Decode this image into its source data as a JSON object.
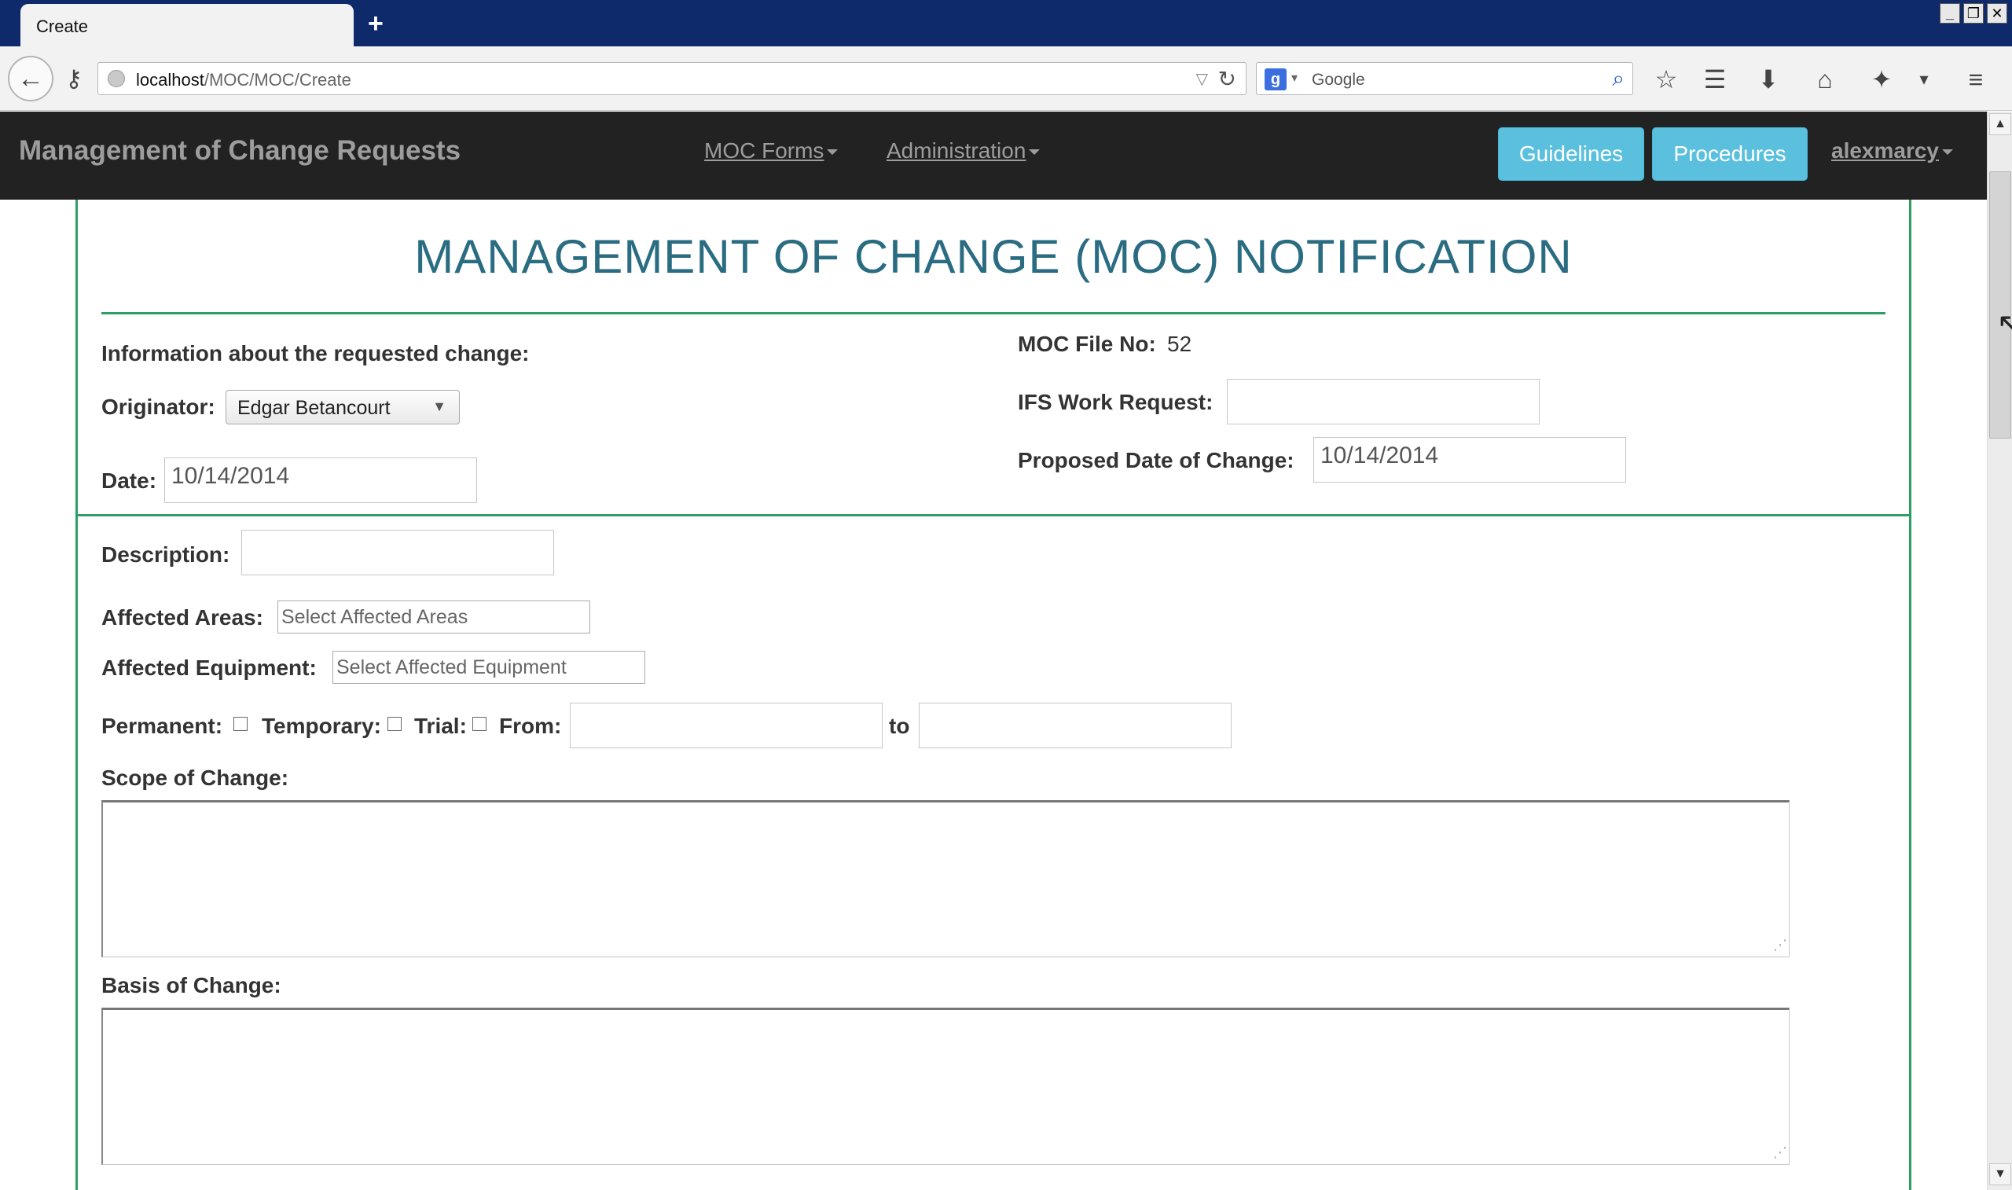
{
  "browser": {
    "tab_title": "Create",
    "new_tab_symbol": "+",
    "url_host": "localhost",
    "url_path": "/MOC/MOC/Create",
    "search_engine_placeholder": "Google",
    "window_minimize": "_",
    "window_restore": "❐",
    "window_close": "✕"
  },
  "app": {
    "brand": "Management of Change Requests",
    "nav": {
      "moc_forms": "MOC Forms",
      "administration": "Administration",
      "guidelines": "Guidelines",
      "procedures": "Procedures",
      "user": "alexmarcy"
    }
  },
  "form": {
    "title": "MANAGEMENT OF CHANGE (MOC) NOTIFICATION",
    "info_heading": "Information about the requested change:",
    "originator_label": "Originator:",
    "originator_value": "Edgar Betancourt",
    "date_label": "Date:",
    "date_value": "10/14/2014",
    "moc_file_no_label": "MOC File No:",
    "moc_file_no_value": "52",
    "ifs_work_request_label": "IFS Work Request:",
    "ifs_work_request_value": "",
    "proposed_date_label": "Proposed Date of Change:",
    "proposed_date_value": "10/14/2014",
    "description_label": "Description:",
    "description_value": "",
    "affected_areas_label": "Affected Areas:",
    "affected_areas_placeholder": "Select Affected Areas",
    "affected_equipment_label": "Affected Equipment:",
    "affected_equipment_placeholder": "Select Affected Equipment",
    "permanent_label": "Permanent:",
    "temporary_label": "Temporary:",
    "trial_label": "Trial:",
    "from_label": "From:",
    "from_value": "",
    "to_label": "to",
    "to_value": "",
    "scope_label": "Scope of Change:",
    "scope_value": "",
    "basis_label": "Basis of Change:",
    "basis_value": ""
  }
}
